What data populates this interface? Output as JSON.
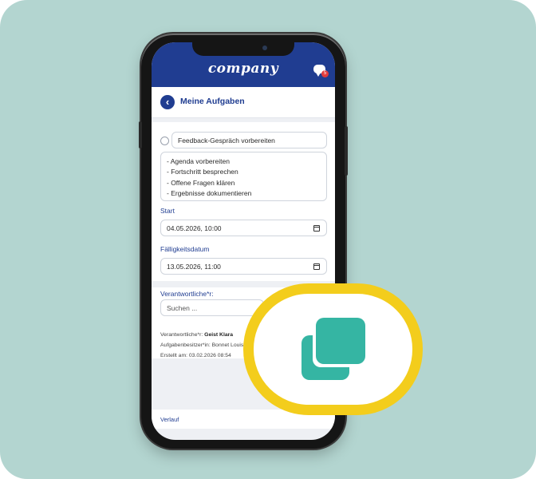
{
  "app": {
    "brand": "company",
    "notification_count": "5"
  },
  "page": {
    "title": "Meine Aufgaben"
  },
  "task": {
    "title": "Feedback-Gespräch vorbereiten",
    "description_lines": [
      "- Agenda vorbereiten",
      "- Fortschritt besprechen",
      "- Offene Fragen klären",
      "- Ergebnisse dokumentieren"
    ],
    "start_label": "Start",
    "start_value": "04.05.2026, 10:00",
    "due_label": "Fälligkeitsdatum",
    "due_value": "13.05.2026, 11:00",
    "responsible_label": "Verantwortliche*r:",
    "search_placeholder": "Suchen ..."
  },
  "meta": {
    "responsible_label": "Verantwortliche*r:",
    "responsible_name": "Geist Klara",
    "owner_label": "Aufgabenbesitzer*in:",
    "owner_name": "Bonnet Louise",
    "created_label": "Erstellt am:",
    "created_value": "03.02.2026 08:54"
  },
  "footer": {
    "history_label": "Verlauf"
  },
  "colors": {
    "background": "#b3d5d0",
    "primary": "#203d91",
    "accent_ring": "#f3cd1c",
    "icon": "#35b5a3",
    "badge": "#e23b3b"
  },
  "icons": [
    "chat-icon",
    "back-arrow-icon",
    "calendar-icon",
    "copy-duplicate-icon"
  ]
}
